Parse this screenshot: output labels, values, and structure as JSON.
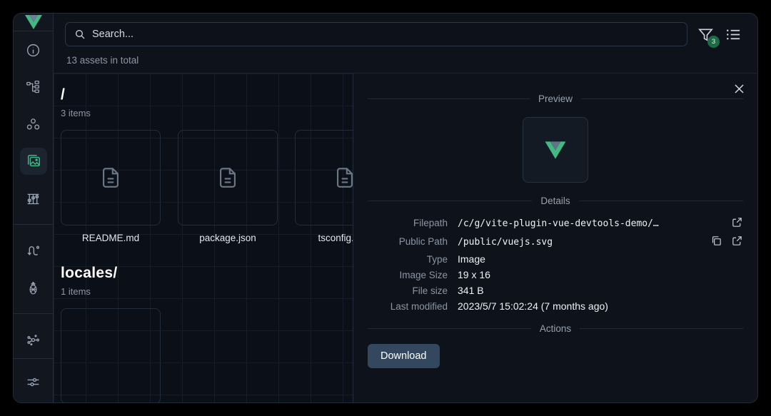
{
  "app": {
    "logo": "vue-logo"
  },
  "sidebar": {
    "items": [
      {
        "name": "overview",
        "icon": "info-circle-icon",
        "active": false
      },
      {
        "name": "components",
        "icon": "component-tree-icon",
        "active": false
      },
      {
        "name": "pages",
        "icon": "nodes-icon",
        "active": false
      },
      {
        "name": "assets",
        "icon": "images-icon",
        "active": true
      },
      {
        "name": "timeline",
        "icon": "timeline-icon",
        "active": false
      },
      {
        "name": "routes",
        "icon": "route-icon",
        "active": false
      },
      {
        "name": "pinia",
        "icon": "pineapple-icon",
        "active": false
      },
      {
        "name": "graph",
        "icon": "graph-icon",
        "active": false
      },
      {
        "name": "settings",
        "icon": "sliders-icon",
        "active": false
      }
    ]
  },
  "search": {
    "placeholder": "Search...",
    "value": "",
    "icon": "search-icon"
  },
  "toolbar": {
    "filter_icon": "filter-icon",
    "filter_badge": "3",
    "list_view_icon": "list-icon"
  },
  "status": {
    "asset_count": "13 assets in total"
  },
  "folders": [
    {
      "name": "/",
      "items_label": "3 items",
      "files": [
        {
          "label": "README.md",
          "icon": "file-icon"
        },
        {
          "label": "package.json",
          "icon": "file-icon"
        },
        {
          "label": "tsconfig.json",
          "icon": "file-icon"
        }
      ]
    },
    {
      "name": "locales/",
      "items_label": "1 items",
      "files": [
        {
          "label": "",
          "icon": "file-icon"
        }
      ]
    }
  ],
  "details": {
    "close_icon": "close-icon",
    "preview_title": "Preview",
    "preview_asset": "vue-logo",
    "details_title": "Details",
    "rows": [
      {
        "label": "Filepath",
        "value": "/c/g/vite-plugin-vue-devtools-demo/…",
        "mono": true,
        "icons": [
          "external-link-icon"
        ]
      },
      {
        "label": "Public Path",
        "value": "/public/vuejs.svg",
        "mono": true,
        "icons": [
          "copy-icon",
          "external-link-icon"
        ]
      },
      {
        "label": "Type",
        "value": "Image",
        "mono": false,
        "icons": []
      },
      {
        "label": "Image Size",
        "value": "19 x 16",
        "mono": false,
        "icons": []
      },
      {
        "label": "File size",
        "value": "341 B",
        "mono": false,
        "icons": []
      },
      {
        "label": "Last modified",
        "value": "2023/5/7 15:02:24 (7 months ago)",
        "mono": false,
        "icons": []
      }
    ],
    "actions_title": "Actions",
    "download_label": "Download"
  },
  "colors": {
    "accent_green": "#3fb883",
    "badge_green": "#1d6b46",
    "button_blue": "#33485e",
    "window_bg": "#0e131b"
  }
}
